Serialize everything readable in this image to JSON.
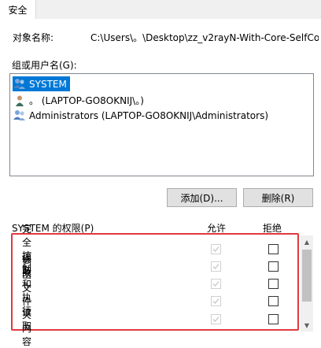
{
  "tabs": [
    {
      "label": "安全"
    }
  ],
  "object_name": {
    "label": "对象名称:",
    "value": "C:\\Users\\。\\Desktop\\zz_v2rayN-With-Core-SelfCo"
  },
  "principals": {
    "label": "组或用户名(G):",
    "items": [
      {
        "name": "SYSTEM",
        "icon": "users-group-icon",
        "selected": true
      },
      {
        "name": "。 (LAPTOP-GO8OKNIJ\\。)",
        "icon": "user-icon",
        "selected": false
      },
      {
        "name": "Administrators (LAPTOP-GO8OKNIJ\\Administrators)",
        "icon": "users-group-icon",
        "selected": false
      }
    ]
  },
  "buttons": {
    "add": "添加(D)...",
    "remove": "删除(R)"
  },
  "permissions": {
    "header": "SYSTEM 的权限(P)",
    "allow_header": "允许",
    "deny_header": "拒绝",
    "rows": [
      {
        "name": "完全控制",
        "allow": true,
        "deny": false
      },
      {
        "name": "修改",
        "allow": true,
        "deny": false
      },
      {
        "name": "读取和执行",
        "allow": true,
        "deny": false
      },
      {
        "name": "列出文件夹内容",
        "allow": true,
        "deny": false
      },
      {
        "name": "读取",
        "allow": true,
        "deny": false
      }
    ]
  },
  "colors": {
    "selection": "#0078d7",
    "highlight_border": "#e0393e"
  }
}
